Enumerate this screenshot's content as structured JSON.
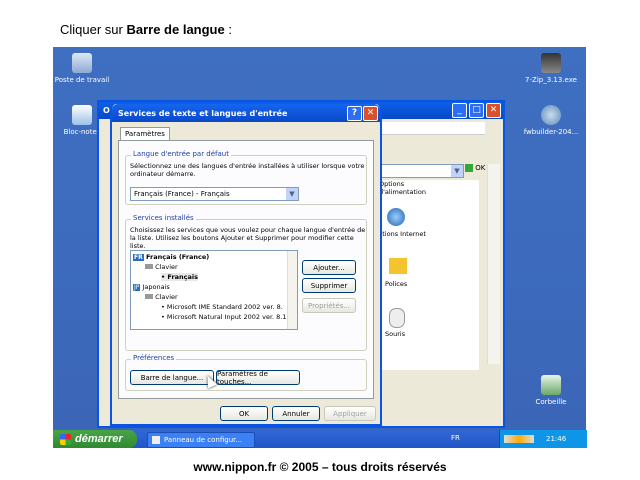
{
  "instruction": {
    "prefix": "Cliquer sur ",
    "bold": "Barre de langue",
    "suffix": " :"
  },
  "desktop_icons": [
    {
      "label": "Poste de travail"
    },
    {
      "label": "Bloc-notes"
    },
    {
      "label": "7-Zip_3.13.exe"
    },
    {
      "label": "fwbuilder-204..."
    },
    {
      "label": "Corbeille"
    }
  ],
  "bg_window": {
    "title": "Op",
    "items": [
      "Options d'alimentation",
      "Options Internet",
      "Polices",
      "Souris"
    ],
    "ok_label": "OK"
  },
  "dialog": {
    "title": "Services de texte et langues d'entrée",
    "help": "?",
    "close": "✕",
    "tab": "Paramètres",
    "default_group": {
      "label": "Langue d'entrée par défaut",
      "desc1": "Sélectionnez une des langues d'entrée installées à utiliser lorsque votre",
      "desc2": "ordinateur démarre.",
      "select_value": "Français (France) - Français"
    },
    "installed_group": {
      "label": "Services installés",
      "desc1": "Choisissez les services que vous voulez pour chaque langue d'entrée de",
      "desc2": "la liste. Utilisez les boutons Ajouter et Supprimer pour modifier cette liste.",
      "tree": [
        {
          "badge": "FR",
          "text": "Français (France)"
        },
        {
          "text": "Clavier"
        },
        {
          "text": "Français"
        },
        {
          "badge": "JP",
          "text": "Japonais"
        },
        {
          "text": "Clavier"
        },
        {
          "text": "Microsoft IME Standard 2002 ver. 8."
        },
        {
          "text": "Microsoft Natural Input 2002 ver. 8.1"
        }
      ],
      "add": "Ajouter...",
      "remove": "Supprimer",
      "props": "Propriétés..."
    },
    "prefs_group": {
      "label": "Préférences",
      "langbar": "Barre de langue...",
      "keys": "Paramètres de touches..."
    },
    "ok": "OK",
    "cancel": "Annuler",
    "apply": "Appliquer"
  },
  "taskbar": {
    "start": "démarrer",
    "task": "Panneau de configur...",
    "lang": "FR",
    "clock": "21:46"
  },
  "footer": "www.nippon.fr © 2005 – tous droits réservés"
}
